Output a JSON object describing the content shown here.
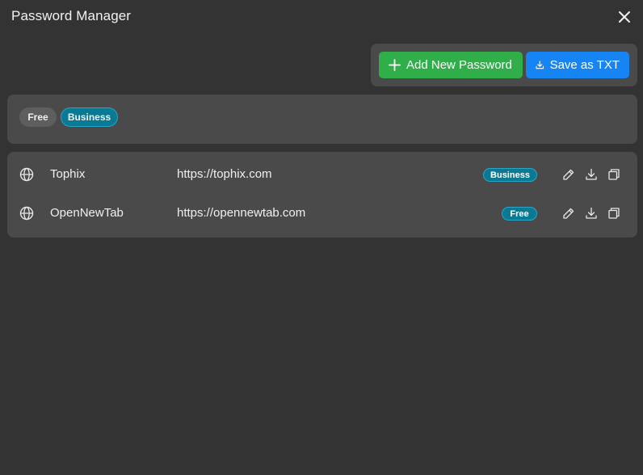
{
  "window": {
    "title": "Password Manager"
  },
  "toolbar": {
    "add_label": "Add New Password",
    "save_label": "Save as TXT"
  },
  "filters": [
    {
      "label": "Free",
      "active": false
    },
    {
      "label": "Business",
      "active": true
    }
  ],
  "passwords": [
    {
      "name": "Tophix",
      "url": "https://tophix.com",
      "category": "Business",
      "icon": "globe-icon"
    },
    {
      "name": "OpenNewTab",
      "url": "https://opennewtab.com",
      "category": "Free",
      "icon": "globe-icon"
    }
  ],
  "colors": {
    "background": "#333333",
    "panel": "#4a4a4a",
    "add_button": "#2fae49",
    "save_button": "#1784f3",
    "badge": "#0a7a94",
    "chip_inactive": "#5e5e5e"
  }
}
